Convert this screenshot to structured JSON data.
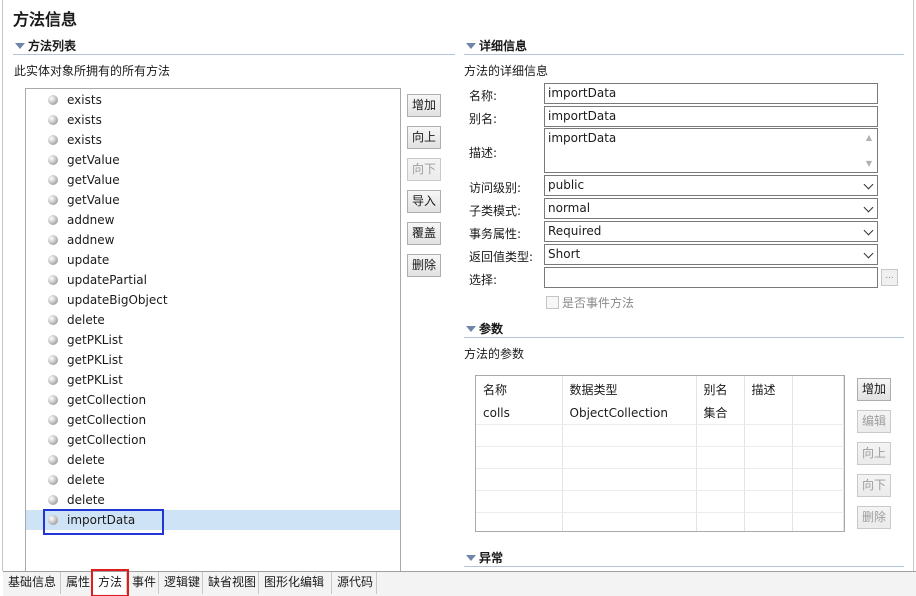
{
  "page_title": "方法信息",
  "method_section": {
    "title": "方法列表",
    "description": "此实体对象所拥有的所有方法",
    "items": [
      "exists",
      "exists",
      "exists",
      "getValue",
      "getValue",
      "getValue",
      "addnew",
      "addnew",
      "update",
      "updatePartial",
      "updateBigObject",
      "delete",
      "getPKList",
      "getPKList",
      "getPKList",
      "getCollection",
      "getCollection",
      "getCollection",
      "delete",
      "delete",
      "delete",
      "importData"
    ],
    "selected_index": 21,
    "buttons": {
      "add": "增加",
      "up": "向上",
      "down": "向下",
      "import": "导入",
      "override": "覆盖",
      "delete": "删除"
    }
  },
  "detail_section": {
    "title": "详细信息",
    "description": "方法的详细信息",
    "labels": {
      "name": "名称:",
      "alias": "别名:",
      "desc": "描述:",
      "access": "访问级别:",
      "subclass": "子类模式:",
      "transaction": "事务属性:",
      "return_type": "返回值类型:",
      "choose": "选择:"
    },
    "values": {
      "name": "importData",
      "alias": "importData",
      "desc": "importData",
      "access": "public",
      "subclass": "normal",
      "transaction": "Required",
      "return_type": "Short",
      "choose": ""
    },
    "ellipsis": "...",
    "event_checkbox": "是否事件方法",
    "event_checked": false
  },
  "params_section": {
    "title": "参数",
    "description": "方法的参数",
    "columns": [
      "名称",
      "数据类型",
      "别名",
      "描述"
    ],
    "rows": [
      [
        "colls",
        "ObjectCollection",
        "集合",
        ""
      ]
    ],
    "buttons": {
      "add": "增加",
      "edit": "编辑",
      "up": "向上",
      "down": "向下",
      "delete": "删除"
    }
  },
  "exception_section": {
    "title": "异常"
  },
  "tabs": [
    "基础信息",
    "属性",
    "方法",
    "事件",
    "逻辑键",
    "缺省视图",
    "图形化编辑",
    "源代码"
  ],
  "active_tab": 2
}
